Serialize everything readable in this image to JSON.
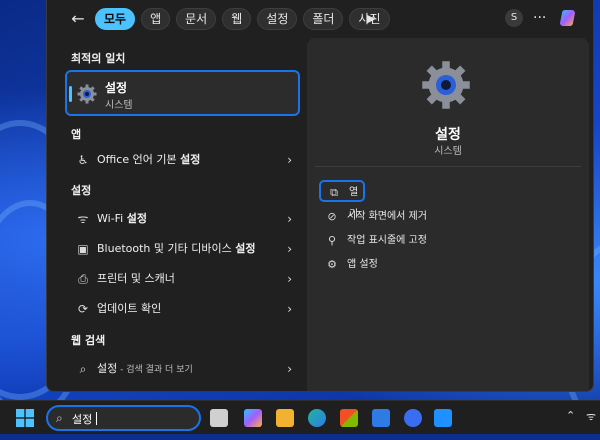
{
  "filters": {
    "chips": [
      "모두",
      "앱",
      "문서",
      "웹",
      "설정",
      "폴더",
      "사진"
    ],
    "active_index": 0,
    "avatar_letter": "S",
    "more": "···"
  },
  "sections": {
    "best_match": "최적의 일치",
    "apps": "앱",
    "settings": "설정",
    "web": "웹 검색"
  },
  "best_match": {
    "title": "설정",
    "subtitle": "시스템"
  },
  "apps": [
    {
      "icon": "accessibility-icon",
      "label_plain": "Office 언어 기본 ",
      "label_bold": "설정"
    }
  ],
  "settings": [
    {
      "icon": "wifi-icon",
      "label_plain": "Wi-Fi ",
      "label_bold": "설정"
    },
    {
      "icon": "bluetooth-devices-icon",
      "label_plain": "Bluetooth 및 기타 디바이스 ",
      "label_bold": "설정"
    },
    {
      "icon": "printer-icon",
      "label_plain": "프린터 및 스캐너",
      "label_bold": ""
    },
    {
      "icon": "update-icon",
      "label_plain": "업데이트 확인",
      "label_bold": ""
    }
  ],
  "web": {
    "label": "설정",
    "suffix": " - 검색 결과 더 보기"
  },
  "detail": {
    "title": "설정",
    "subtitle": "시스템",
    "actions": [
      {
        "icon": "open-icon",
        "label": "열기"
      },
      {
        "icon": "unpin-start-icon",
        "label": "시작 화면에서 제거"
      },
      {
        "icon": "pin-taskbar-icon",
        "label": "작업 표시줄에 고정"
      },
      {
        "icon": "app-settings-icon",
        "label": "앱 설정"
      }
    ]
  },
  "taskbar": {
    "search_value": "설정"
  },
  "colors": {
    "accent": "#4cc2ff",
    "focus_outline": "#1a73e8"
  }
}
